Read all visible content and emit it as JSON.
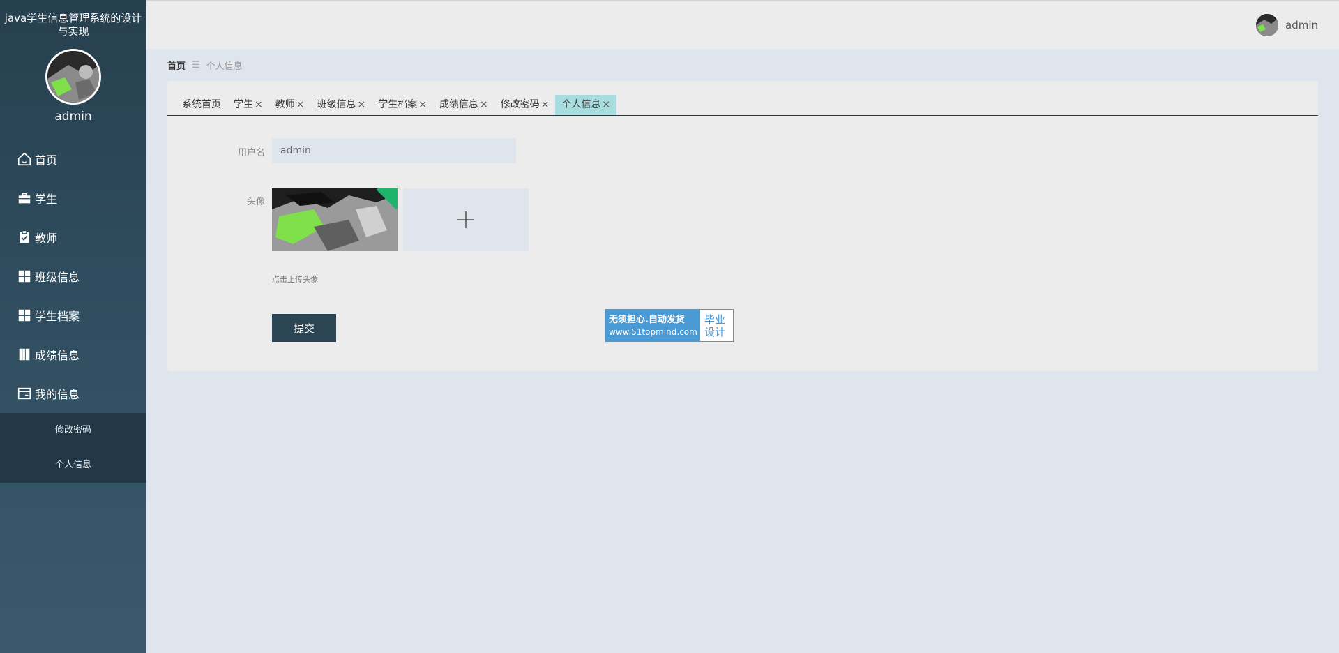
{
  "app": {
    "title": "java学生信息管理系统的设计与实现",
    "username": "admin"
  },
  "sidebar": {
    "items": [
      {
        "label": "首页",
        "icon": "home-icon"
      },
      {
        "label": "学生",
        "icon": "briefcase-icon"
      },
      {
        "label": "教师",
        "icon": "clipboard-icon"
      },
      {
        "label": "班级信息",
        "icon": "grid-icon"
      },
      {
        "label": "学生档案",
        "icon": "grid-icon"
      },
      {
        "label": "成绩信息",
        "icon": "book-icon"
      },
      {
        "label": "我的信息",
        "icon": "card-icon"
      }
    ],
    "submenu": [
      {
        "label": "修改密码"
      },
      {
        "label": "个人信息"
      }
    ]
  },
  "topbar": {
    "username": "admin"
  },
  "breadcrumb": {
    "home": "首页",
    "separator": "☰",
    "current": "个人信息"
  },
  "tabs": [
    {
      "label": "系统首页",
      "closable": false
    },
    {
      "label": "学生",
      "closable": true
    },
    {
      "label": "教师",
      "closable": true
    },
    {
      "label": "班级信息",
      "closable": true
    },
    {
      "label": "学生档案",
      "closable": true
    },
    {
      "label": "成绩信息",
      "closable": true
    },
    {
      "label": "修改密码",
      "closable": true
    },
    {
      "label": "个人信息",
      "closable": true,
      "active": true
    }
  ],
  "tab_close_glyph": "×",
  "form": {
    "username_label": "用户名",
    "username_value": "admin",
    "avatar_label": "头像",
    "upload_hint": "点击上传头像",
    "submit_label": "提交"
  },
  "promo": {
    "line1": "无须担心.自动发货",
    "line2": "www.51topmind.com",
    "right1": "毕业",
    "right2": "设计"
  },
  "colors": {
    "sidebar": "#2f4d5e",
    "active_tab": "#a8dde0",
    "submit": "#2c4555",
    "promo": "#4a9ad6"
  }
}
